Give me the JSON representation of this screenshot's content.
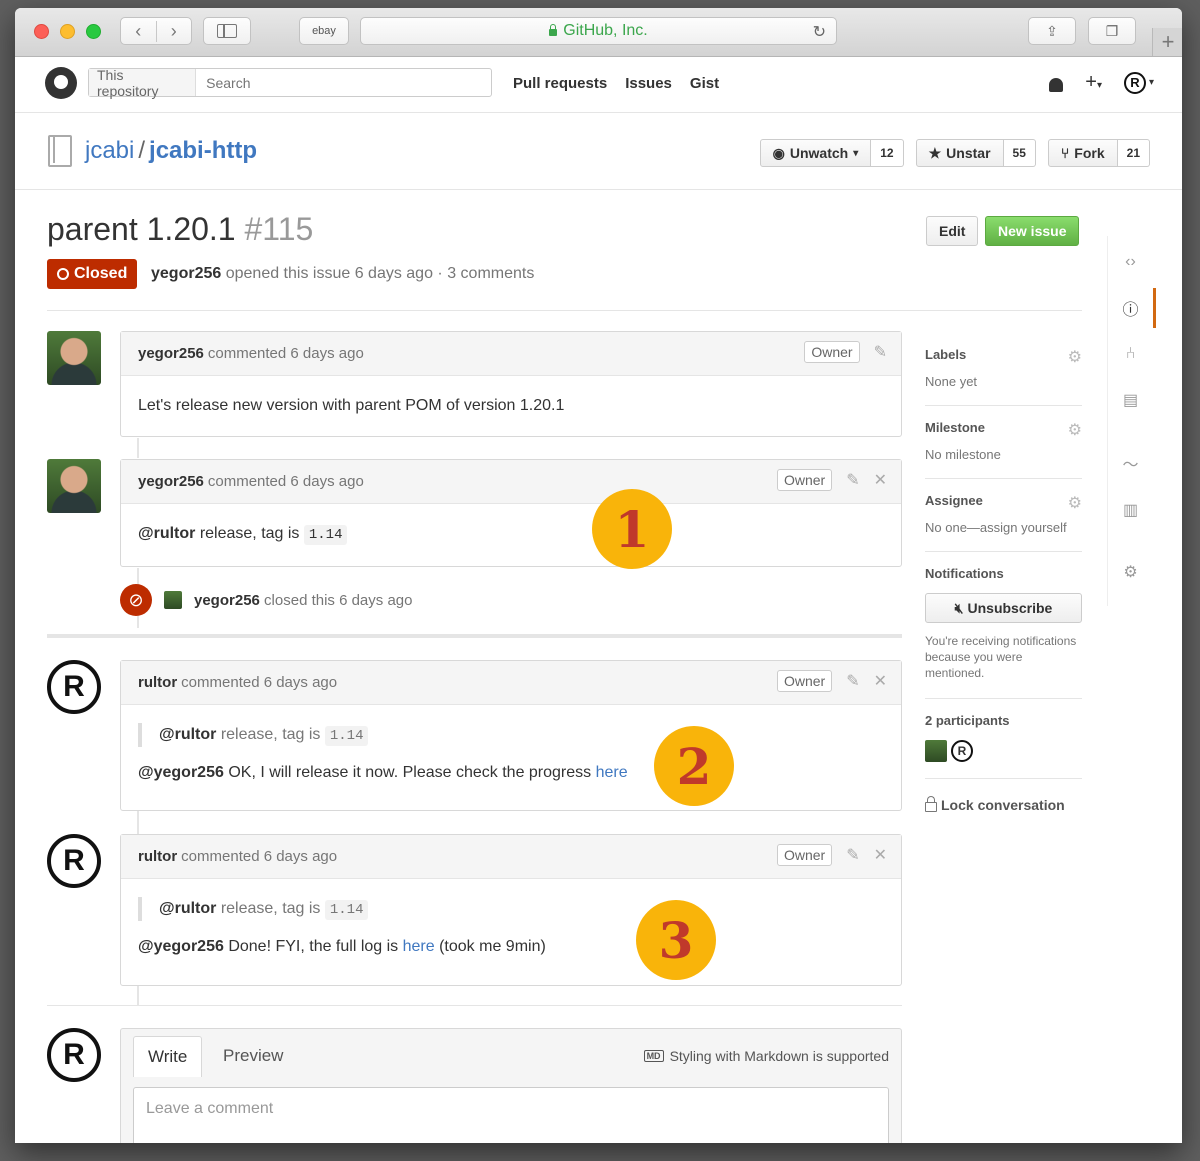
{
  "browser": {
    "bookmark": "ebay",
    "url_title": "GitHub, Inc."
  },
  "header": {
    "scope": "This repository",
    "search_placeholder": "Search",
    "nav": [
      "Pull requests",
      "Issues",
      "Gist"
    ]
  },
  "repo": {
    "owner": "jcabi",
    "name": "jcabi-http",
    "unwatch_label": "Unwatch",
    "watch_count": "12",
    "unstar_label": "Unstar",
    "star_count": "55",
    "fork_label": "Fork",
    "fork_count": "21"
  },
  "issue": {
    "title": "parent 1.20.1",
    "number": "#115",
    "edit_label": "Edit",
    "new_issue_label": "New issue",
    "state": "Closed",
    "author": "yegor256",
    "meta_text": "opened this issue 6 days ago · 3 comments"
  },
  "comments": [
    {
      "author": "yegor256",
      "time": "commented 6 days ago",
      "badge": "Owner",
      "body": "Let's release new version with parent POM of version 1.20.1"
    },
    {
      "author": "yegor256",
      "time": "commented 6 days ago",
      "badge": "Owner",
      "mention": "@rultor",
      "text": " release, tag is ",
      "code": "1.14",
      "marker": "1"
    },
    {
      "author": "rultor",
      "time": "commented 6 days ago",
      "badge": "Owner",
      "quote_mention": "@rultor",
      "quote_text": " release, tag is ",
      "quote_code": "1.14",
      "mention": "@yegor256",
      "text": " OK, I will release it now. Please check the progress ",
      "link": "here",
      "marker": "2"
    },
    {
      "author": "rultor",
      "time": "commented 6 days ago",
      "badge": "Owner",
      "quote_mention": "@rultor",
      "quote_text": " release, tag is ",
      "quote_code": "1.14",
      "mention": "@yegor256",
      "text": " Done! FYI, the full log is ",
      "link": "here",
      "after": " (took me 9min)",
      "marker": "3"
    }
  ],
  "closed_event": {
    "actor": "yegor256",
    "text": "closed this 6 days ago"
  },
  "compose": {
    "write_tab": "Write",
    "preview_tab": "Preview",
    "markdown_hint": "Styling with Markdown is supported",
    "markdown_icon": "MD",
    "placeholder": "Leave a comment"
  },
  "sidebar": {
    "labels_title": "Labels",
    "labels_value": "None yet",
    "milestone_title": "Milestone",
    "milestone_value": "No milestone",
    "assignee_title": "Assignee",
    "assignee_value": "No one—assign yourself",
    "notifications_title": "Notifications",
    "unsubscribe_label": "Unsubscribe",
    "notifications_text": "You're receiving notifications because you were mentioned.",
    "participants_title": "2 participants",
    "lock_label": "Lock conversation"
  },
  "icons": {
    "repo_nav": [
      "code-icon",
      "issues-icon",
      "pull-request-icon",
      "wiki-icon",
      "pulse-icon",
      "graphs-icon",
      "settings-icon"
    ]
  },
  "colors": {
    "closed": "#bd2c00",
    "new_issue": "#60b044",
    "link": "#4078c0",
    "marker": "#f9b40a"
  }
}
